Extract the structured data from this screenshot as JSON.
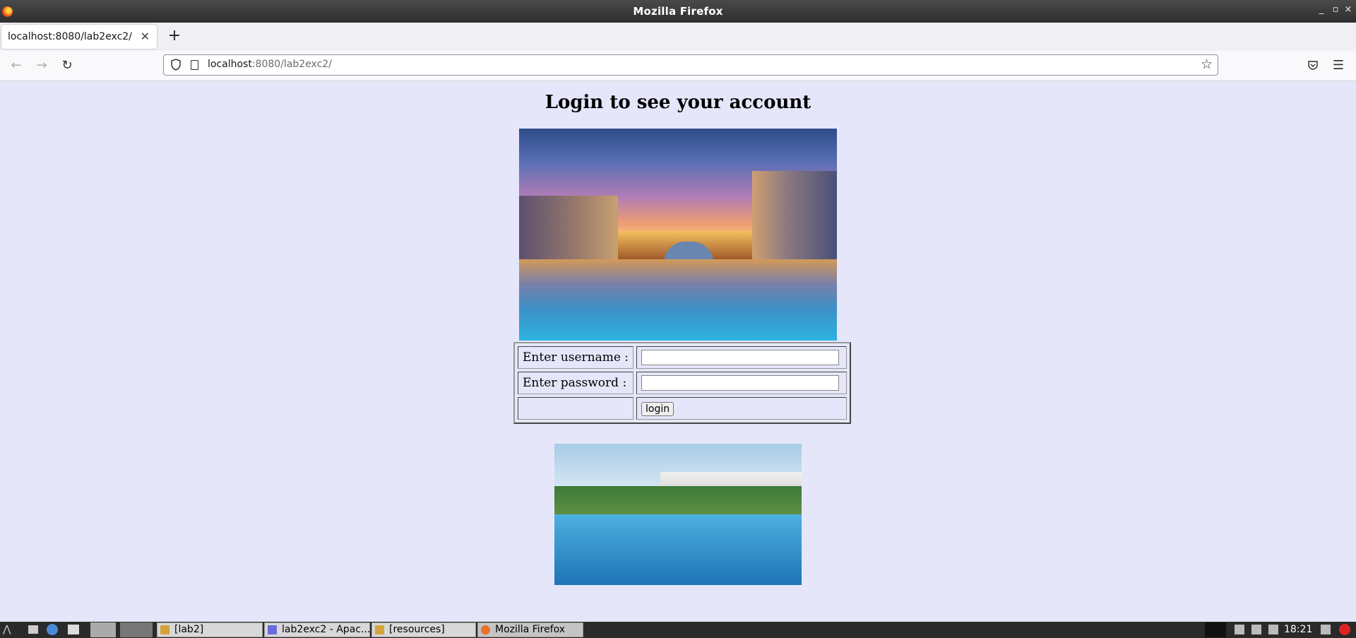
{
  "window": {
    "title": "Mozilla Firefox"
  },
  "tabs": [
    {
      "label": "localhost:8080/lab2exc2/"
    }
  ],
  "new_tab": "+",
  "url_bar": {
    "host": "localhost",
    "rest": ":8080/lab2exc2/"
  },
  "page": {
    "heading": "Login to see your account",
    "form": {
      "username_label": "Enter username :",
      "password_label": "Enter password :",
      "username_value": "",
      "password_value": "",
      "login_label": "login"
    }
  },
  "taskbar": {
    "items": [
      "[lab2]",
      "lab2exc2 - Apac...",
      "[resources]",
      "Mozilla Firefox"
    ],
    "clock": "18:21"
  }
}
